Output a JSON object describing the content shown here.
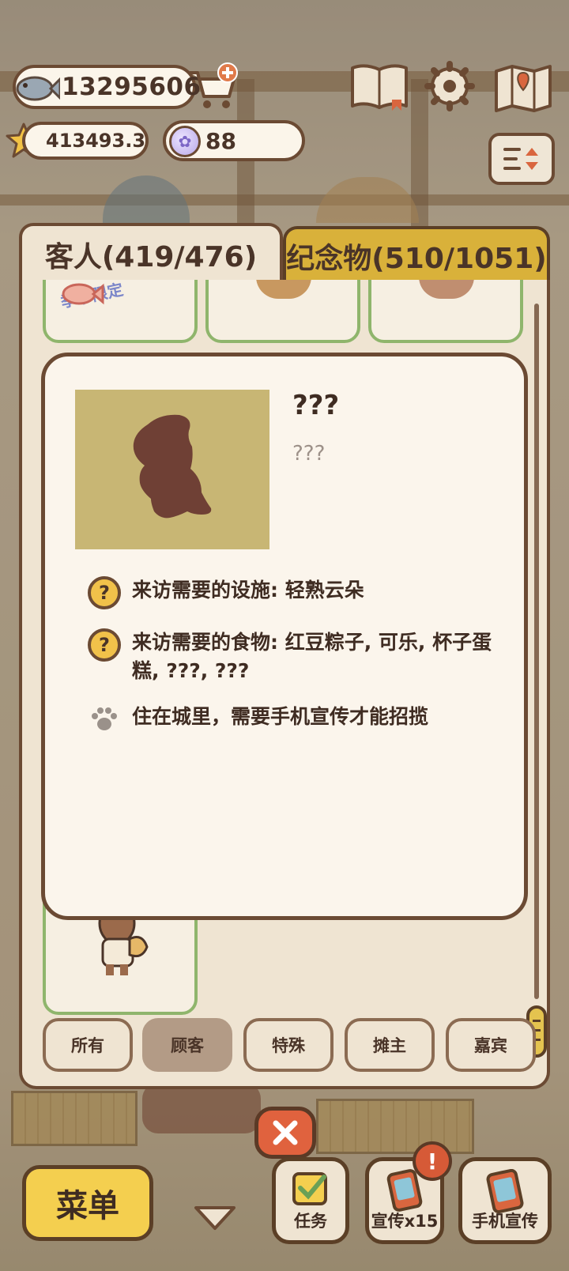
{
  "hud": {
    "fish_count": "13295606",
    "star_count": "413493.3",
    "paw_coins": "88"
  },
  "tabs": {
    "guests": "客人(419/476)",
    "souvenirs": "纪念物(510/1051)"
  },
  "badge": {
    "season": "季节限定"
  },
  "guest_detail": {
    "name": "???",
    "description": "???",
    "facility_requirement": "来访需要的设施: 轻熟云朵",
    "food_requirement": "来访需要的食物: 红豆粽子, 可乐, 杯子蛋糕, ???, ???",
    "note": "住在城里，需要手机宣传才能招揽"
  },
  "filters": [
    {
      "label": "所有",
      "active": false
    },
    {
      "label": "顾客",
      "active": true
    },
    {
      "label": "特殊",
      "active": false
    },
    {
      "label": "摊主",
      "active": false
    },
    {
      "label": "嘉宾",
      "active": false
    }
  ],
  "bottom_bar": {
    "menu": "菜单",
    "tasks": "任务",
    "promo_x15": "宣传x15",
    "phone_promo": "手机宣传",
    "alert": "!"
  },
  "colors": {
    "panel_bg": "#efe4d2",
    "card_bg": "#fbf5ec",
    "outline": "#6b4a33",
    "souvenir_tab": "#d9b13a",
    "accent_green": "#8fb56c",
    "close_red": "#e0623e"
  }
}
